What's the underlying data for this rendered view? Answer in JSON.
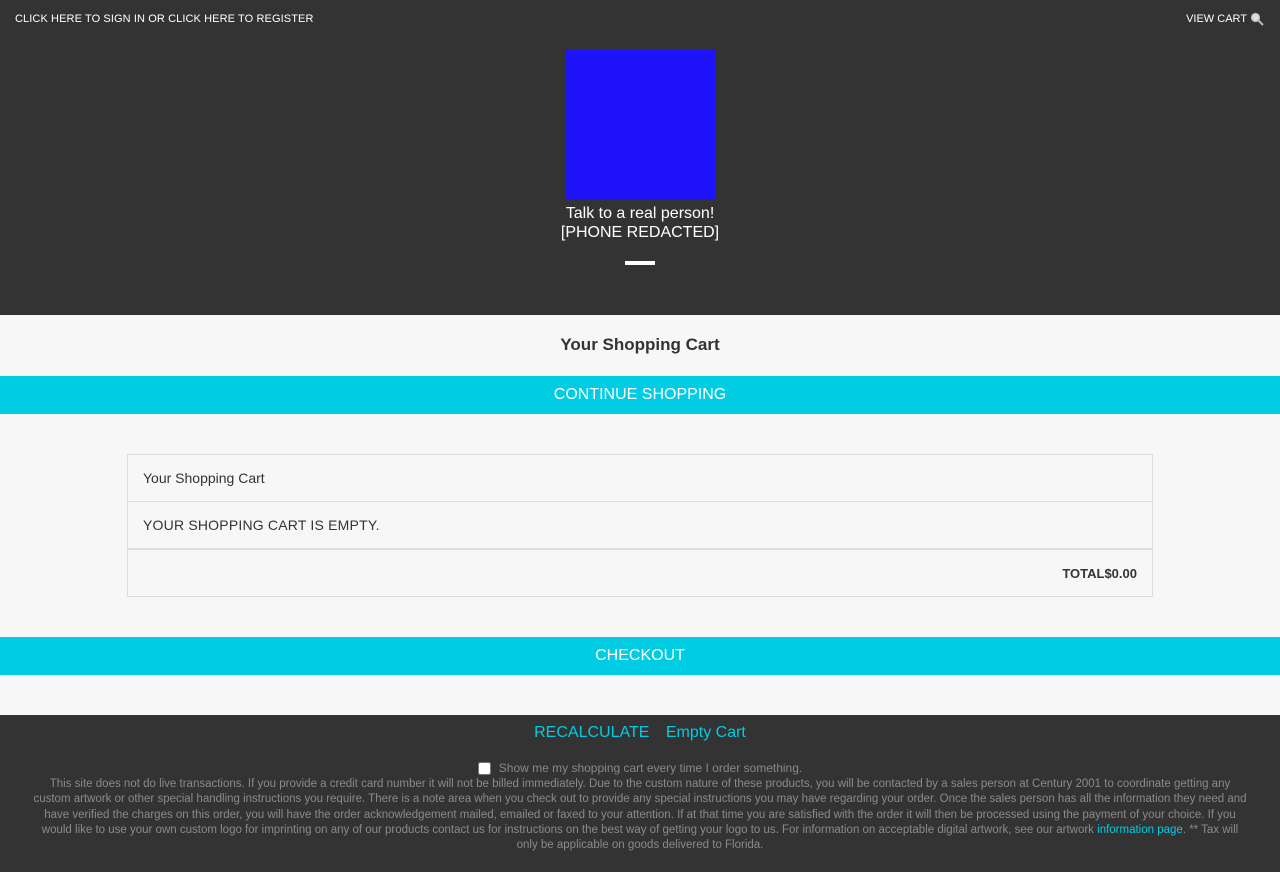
{
  "header": {
    "signin_text": "CLICK HERE TO SIGN IN OR CLICK HERE TO REGISTER",
    "viewcart_label": "VIEW CART",
    "logo_color": "#1f13fa",
    "contact_line1": "Talk to a real person!",
    "contact_line2": "[PHONE REDACTED]"
  },
  "main": {
    "title": "Your Shopping Cart",
    "continue_label": "CONTINUE SHOPPING",
    "checkout_label": "CHECKOUT",
    "accent_color": "#00cce3",
    "table": {
      "header": "Your Shopping Cart",
      "empty_message": "YOUR SHOPPING CART IS EMPTY.",
      "total_label": "TOTAL",
      "total_value": "$0.00"
    }
  },
  "footer": {
    "recalculate_label": "RECALCULATE",
    "empty_cart_label": "Empty Cart",
    "show_cart_label": "Show me my shopping cart every time I order something.",
    "show_cart_checked": false,
    "disclaimer_before": "This site does not do live transactions. If you provide a credit card number it will not be billed immediately. Due to the custom nature of these products, you will be contacted by a sales person at Century 2001 to coordinate getting any custom artwork or other special handling instructions you require. There is a note area when you check out to provide any special instructions you may have regarding your order. Once the sales person has all the information they need and have verified the charges on this order, you will have the order acknowledgement mailed, emailed or faxed to your attention. If at that time you are satisfied with the order it will then be processed using the payment of your choice. If you would like to use your own custom logo for imprinting on any of our products contact us for instructions on the best way of getting your logo to us. For information on acceptable digital artwork, see our artwork ",
    "disclaimer_link": "information page",
    "disclaimer_after": ". ** Tax will only be applicable on goods delivered to Florida."
  }
}
